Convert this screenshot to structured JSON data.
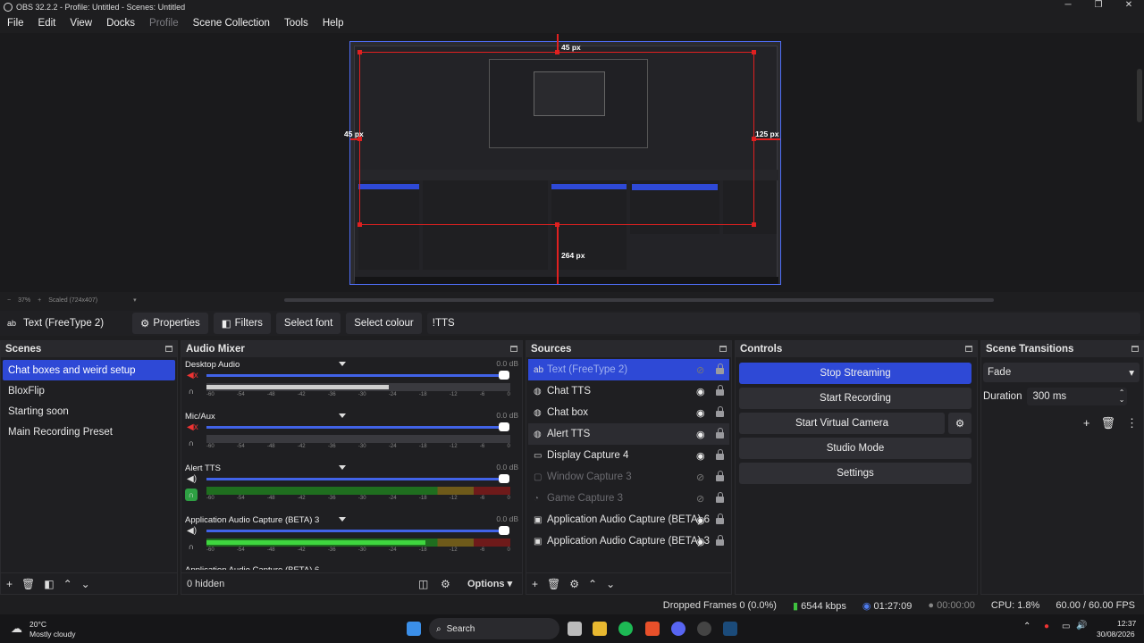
{
  "window": {
    "title": "OBS 32.2.2 - Profile: Untitled - Scenes: Untitled"
  },
  "menu": [
    "File",
    "Edit",
    "View",
    "Docks",
    "Profile",
    "Scene Collection",
    "Tools",
    "Help"
  ],
  "preview": {
    "measure_top": "45 px",
    "measure_left": "45 px",
    "measure_right": "125 px",
    "measure_bottom": "264 px"
  },
  "zoombar": {
    "zoom": "37%",
    "scaled": "Scaled (724x407)"
  },
  "source_toolbar": {
    "name": "Text (FreeType 2)",
    "properties": "Properties",
    "filters": "Filters",
    "select_font": "Select font",
    "select_colour": "Select colour",
    "text": "!TTS"
  },
  "scenes": {
    "title": "Scenes",
    "items": [
      "Chat boxes and weird setup",
      "BloxFlip",
      "Starting soon",
      "Main Recording Preset"
    ]
  },
  "audio_mixer": {
    "title": "Audio Mixer",
    "ticks": [
      "-60",
      "-54",
      "-48",
      "-42",
      "-36",
      "-30",
      "-24",
      "-18",
      "-12",
      "-6",
      "0"
    ],
    "channels": [
      {
        "name": "Desktop Audio",
        "tag": "Global",
        "db": "0.0 dB",
        "level": 0.6
      },
      {
        "name": "Mic/Aux",
        "tag": "Global",
        "db": "0.0 dB",
        "level": 0.0
      },
      {
        "name": "Alert TTS",
        "tag": "Active",
        "db": "0.0 dB",
        "level": 0.0
      },
      {
        "name": "Application Audio Capture (BETA) 3",
        "tag": "Active",
        "db": "0.0 dB",
        "level": 0.72
      }
    ],
    "partial_channel": "Application Audio Capture (BETA) 6",
    "hidden": "0 hidden",
    "options": "Options"
  },
  "sources": {
    "title": "Sources",
    "items": [
      {
        "name": "Text (FreeType 2)",
        "icon": "ab",
        "visible": false,
        "style": "sel"
      },
      {
        "name": "Chat TTS",
        "icon": "globe",
        "visible": true,
        "style": ""
      },
      {
        "name": "Chat box",
        "icon": "globe",
        "visible": true,
        "style": ""
      },
      {
        "name": "Alert TTS",
        "icon": "globe",
        "visible": true,
        "style": "hov"
      },
      {
        "name": "Display Capture 4",
        "icon": "monitor",
        "visible": true,
        "style": ""
      },
      {
        "name": "Window Capture 3",
        "icon": "window",
        "visible": false,
        "style": "dim"
      },
      {
        "name": "Game Capture 3",
        "icon": "gamepad",
        "visible": false,
        "style": "dim"
      },
      {
        "name": "Application Audio Capture (BETA) 6",
        "icon": "app",
        "visible": true,
        "style": ""
      },
      {
        "name": "Application Audio Capture (BETA) 3",
        "icon": "app",
        "visible": true,
        "style": ""
      }
    ]
  },
  "controls": {
    "title": "Controls",
    "stop_streaming": "Stop Streaming",
    "start_recording": "Start Recording",
    "start_virtual_camera": "Start Virtual Camera",
    "studio_mode": "Studio Mode",
    "settings": "Settings"
  },
  "transitions": {
    "title": "Scene Transitions",
    "transition": "Fade",
    "duration_label": "Duration",
    "duration_value": "300 ms"
  },
  "status": {
    "dropped": "Dropped Frames 0 (0.0%)",
    "bitrate": "6544 kbps",
    "stream_time": "01:27:09",
    "rec_time": "00:00:00",
    "cpu": "CPU: 1.8%",
    "fps": "60.00 / 60.00 FPS"
  },
  "taskbar": {
    "temp": "20°C",
    "weather": "Mostly cloudy",
    "search": "Search",
    "time": "12:37",
    "date": "30/08/2026"
  },
  "colors": {
    "accent": "#2e49d6",
    "measure": "#e02020"
  }
}
